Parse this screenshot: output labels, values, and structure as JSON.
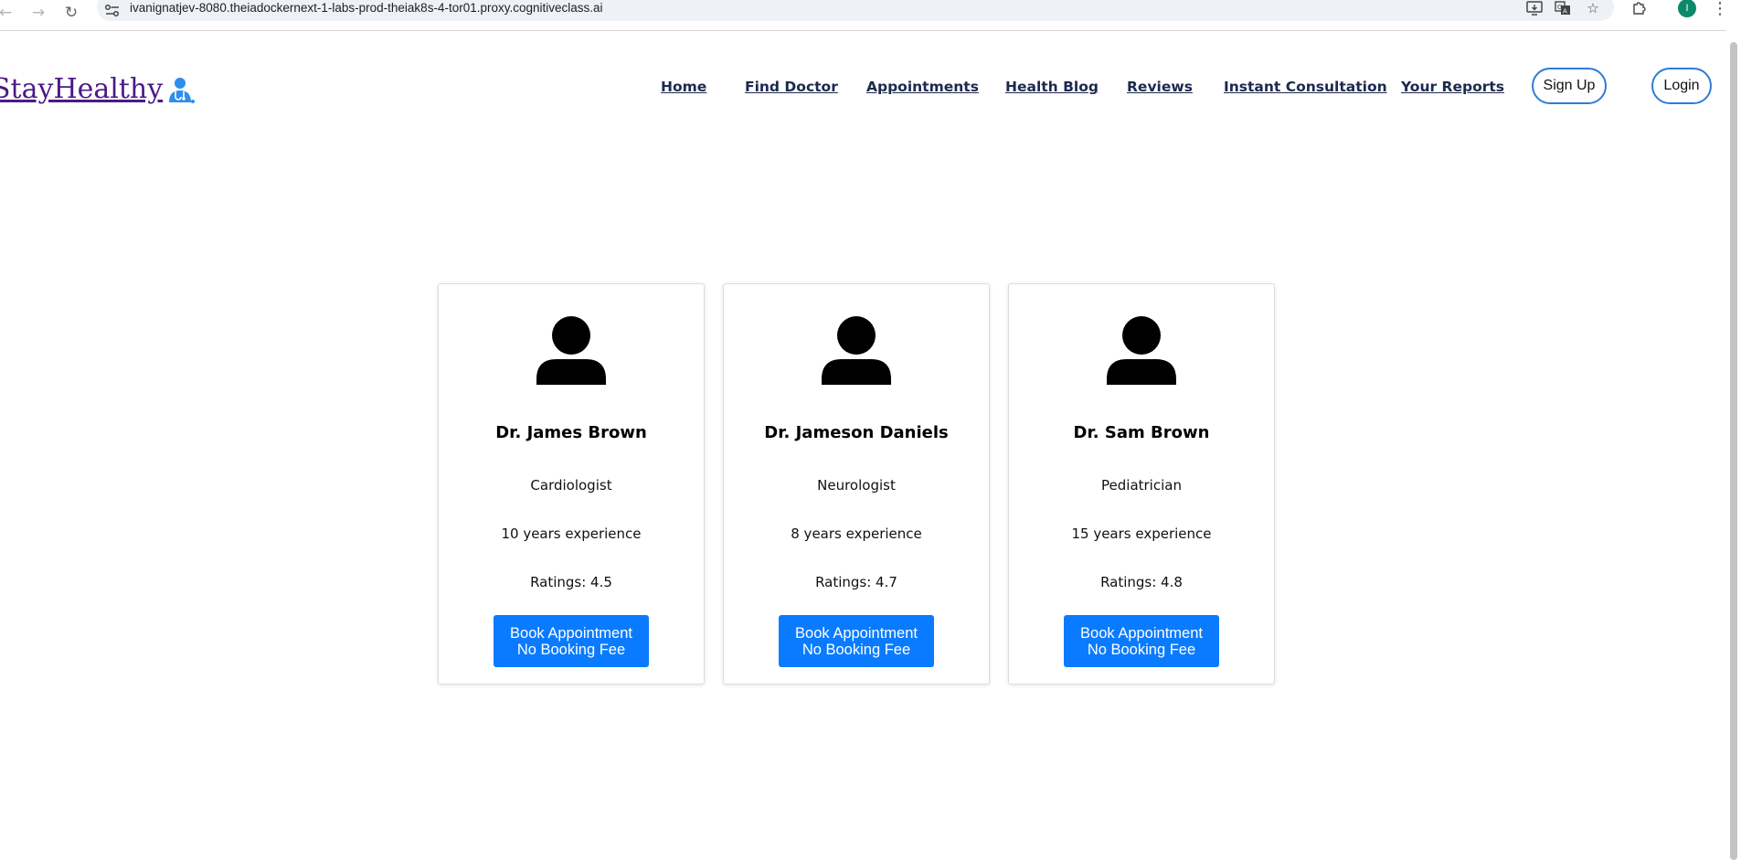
{
  "browser": {
    "url": "ivanignatjev-8080.theiadockernext-1-labs-prod-theiak8s-4-tor01.proxy.cognitiveclass.ai",
    "avatar_letter": "I",
    "icons": [
      "back-arrow-icon",
      "forward-arrow-icon",
      "reload-icon",
      "site-info-icon",
      "install-app-icon",
      "translate-icon",
      "bookmark-star-icon",
      "extensions-icon",
      "menu-dots-icon"
    ]
  },
  "site": {
    "brand": "StayHealthy",
    "brand_color": "#4b1a87",
    "nav": {
      "home": "Home",
      "find_doctor": "Find Doctor",
      "appointments": "Appointments",
      "health_blog": "Health Blog",
      "reviews": "Reviews",
      "instant_consultation": "Instant Consultation",
      "your_reports": "Your Reports",
      "sign_up": "Sign Up",
      "login": "Login"
    }
  },
  "doctors": [
    {
      "name": "Dr. James Brown",
      "speciality": "Cardiologist",
      "experience": "10 years experience",
      "ratings": "Ratings: 4.5",
      "button_line1": "Book Appointment",
      "button_line2": "No Booking Fee"
    },
    {
      "name": "Dr. Jameson Daniels",
      "speciality": "Neurologist",
      "experience": "8 years experience",
      "ratings": "Ratings: 4.7",
      "button_line1": "Book Appointment",
      "button_line2": "No Booking Fee"
    },
    {
      "name": "Dr. Sam Brown",
      "speciality": "Pediatrician",
      "experience": "15 years experience",
      "ratings": "Ratings: 4.8",
      "button_line1": "Book Appointment",
      "button_line2": "No Booking Fee"
    }
  ],
  "colors": {
    "button": "#0a7bff",
    "pill_border": "#2f7bd8",
    "nav_link": "#1c2a4d",
    "avatar": "#0b8a6a"
  }
}
